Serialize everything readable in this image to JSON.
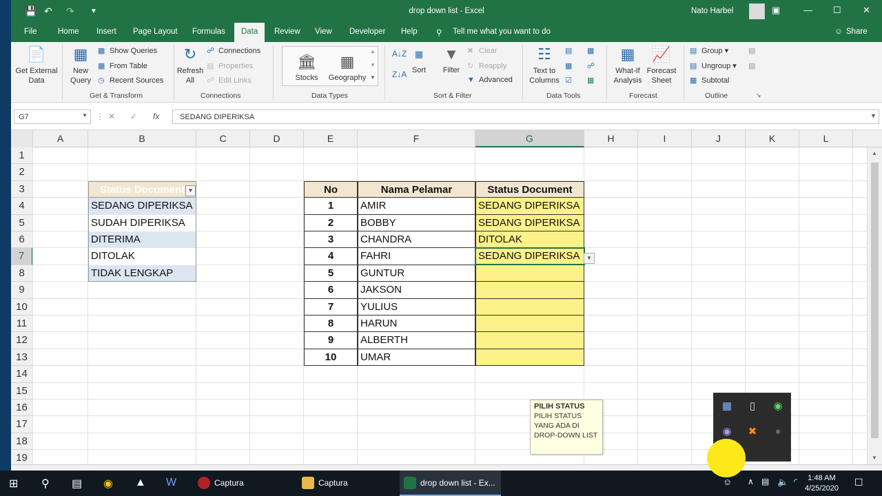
{
  "titlebar": {
    "title": "drop down list  -  Excel",
    "user": "Nato Harbel"
  },
  "tabs": {
    "items": [
      "File",
      "Home",
      "Insert",
      "Page Layout",
      "Formulas",
      "Data",
      "Review",
      "View",
      "Developer",
      "Help"
    ],
    "active": "Data",
    "tell_me": "Tell me what you want to do",
    "share": "Share"
  },
  "ribbon": {
    "get_external_data": "Get External\nData",
    "new_query": "New\nQuery",
    "show_queries": "Show Queries",
    "from_table": "From Table",
    "recent_sources": "Recent Sources",
    "refresh_all": "Refresh\nAll",
    "connections": "Connections",
    "properties": "Properties",
    "edit_links": "Edit Links",
    "stocks": "Stocks",
    "geography": "Geography",
    "sort": "Sort",
    "filter": "Filter",
    "clear": "Clear",
    "reapply": "Reapply",
    "advanced": "Advanced",
    "text_to_columns": "Text to\nColumns",
    "what_if": "What-If\nAnalysis",
    "forecast_sheet": "Forecast\nSheet",
    "group": "Group",
    "ungroup": "Ungroup",
    "subtotal": "Subtotal",
    "groups": {
      "get_transform": "Get & Transform",
      "connections": "Connections",
      "data_types": "Data Types",
      "sort_filter": "Sort & Filter",
      "data_tools": "Data Tools",
      "forecast": "Forecast",
      "outline": "Outline"
    }
  },
  "formula_bar": {
    "name_box": "G7",
    "formula": "SEDANG DIPERIKSA"
  },
  "sheet": {
    "columns": [
      "A",
      "B",
      "C",
      "D",
      "E",
      "F",
      "G",
      "H",
      "I",
      "J",
      "K",
      "L"
    ],
    "rows": [
      "1",
      "2",
      "3",
      "4",
      "5",
      "6",
      "7",
      "8",
      "9",
      "10",
      "11",
      "12",
      "13",
      "14",
      "15",
      "16",
      "17",
      "18",
      "19"
    ],
    "selected_col": "G",
    "selected_row": "7",
    "list_header": "Status Document",
    "list_items": [
      "SEDANG DIPERIKSA",
      "SUDAH DIPERIKSA",
      "DITERIMA",
      "DITOLAK",
      "TIDAK LENGKAP"
    ],
    "table_headers": [
      "No",
      "Nama Pelamar",
      "Status Document"
    ],
    "table_rows": [
      {
        "no": "1",
        "name": "AMIR",
        "status": "SEDANG DIPERIKSA"
      },
      {
        "no": "2",
        "name": "BOBBY",
        "status": "SEDANG DIPERIKSA"
      },
      {
        "no": "3",
        "name": "CHANDRA",
        "status": "DITOLAK"
      },
      {
        "no": "4",
        "name": "FAHRI",
        "status": "SEDANG DIPERIKSA"
      },
      {
        "no": "5",
        "name": "GUNTUR",
        "status": ""
      },
      {
        "no": "6",
        "name": "JAKSON",
        "status": ""
      },
      {
        "no": "7",
        "name": "YULIUS",
        "status": ""
      },
      {
        "no": "8",
        "name": "HARUN",
        "status": ""
      },
      {
        "no": "9",
        "name": "ALBERTH",
        "status": ""
      },
      {
        "no": "10",
        "name": "UMAR",
        "status": ""
      }
    ],
    "tooltip_title": "PILIH STATUS",
    "tooltip_body": "PILIH STATUS YANG ADA DI DROP-DOWN LIST"
  },
  "taskbar": {
    "apps": [
      "Captura",
      "Captura",
      "drop down list - Ex..."
    ],
    "time": "1:48 AM",
    "date": "4/25/2020"
  },
  "colors": {
    "excel_green": "#217346",
    "header_fill": "#f2e6cf",
    "status_fill": "#fdf18a",
    "list_fill": "#dce6f1"
  }
}
